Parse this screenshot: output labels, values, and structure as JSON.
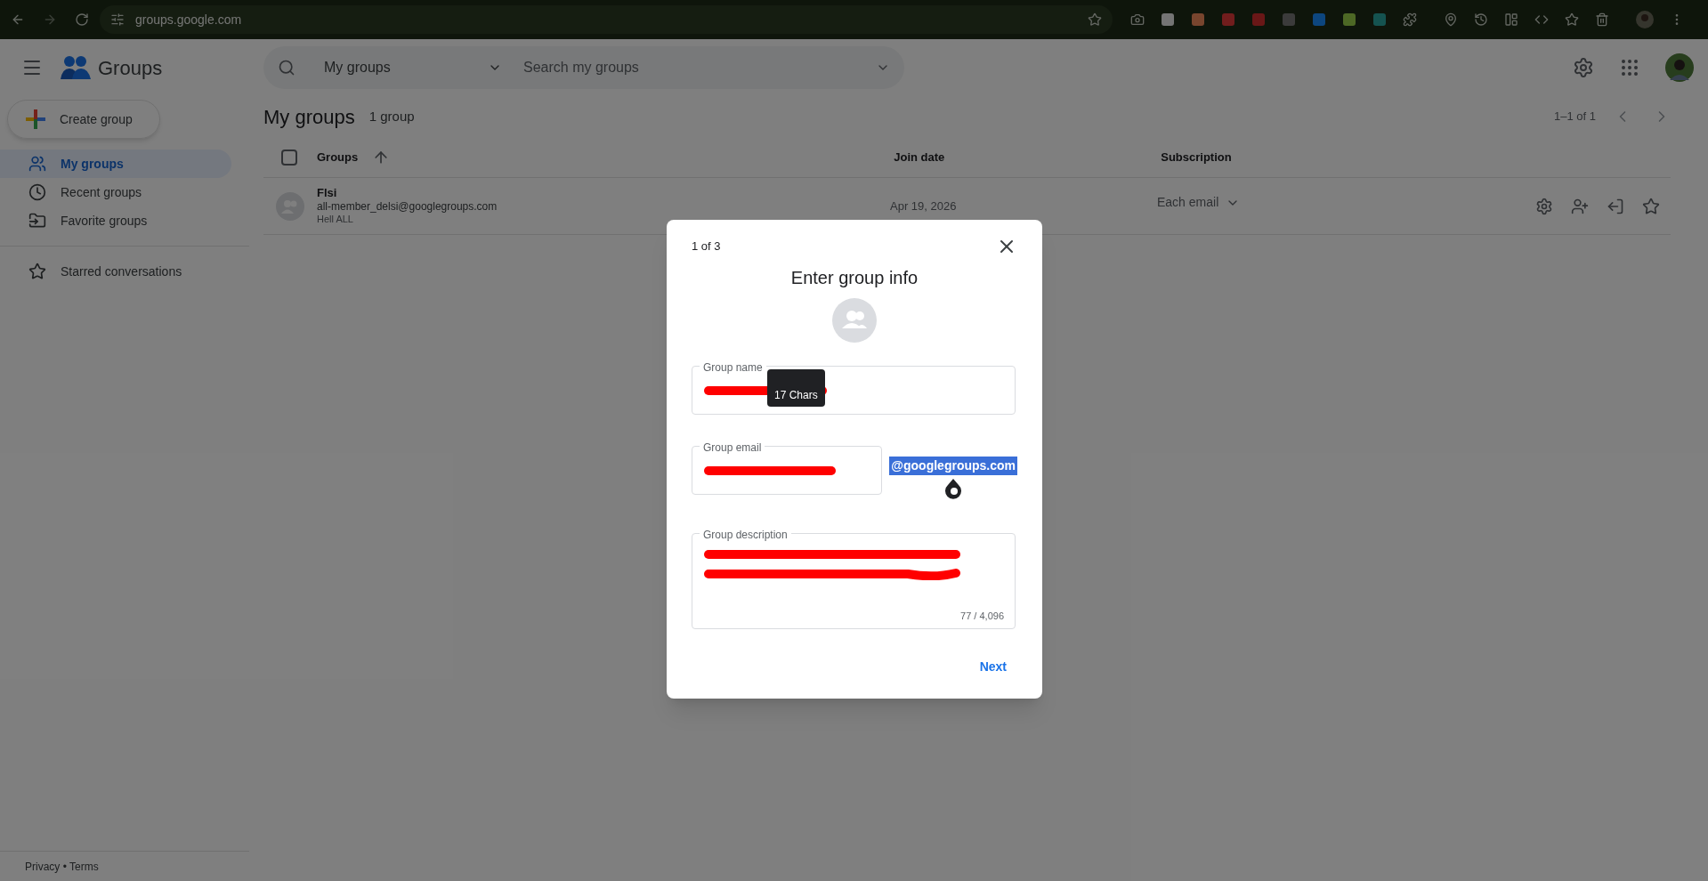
{
  "browser": {
    "url": "groups.google.com"
  },
  "app": {
    "title": "Groups",
    "search": {
      "scope": "My groups",
      "placeholder": "Search my groups"
    }
  },
  "sidebar": {
    "create_button": "Create group",
    "items": [
      {
        "label": "My groups",
        "selected": true,
        "kind": "people"
      },
      {
        "label": "Recent groups",
        "selected": false,
        "kind": "clock"
      },
      {
        "label": "Favorite groups",
        "selected": false,
        "kind": "folder"
      },
      {
        "label": "Starred conversations",
        "selected": false,
        "kind": "star"
      }
    ],
    "footer": "Privacy • Terms"
  },
  "main": {
    "heading": "My groups",
    "count": "1 group",
    "pagination": "1–1 of 1",
    "select_all": {
      "checked": false
    },
    "columns": [
      "Groups",
      "Join date",
      "Subscription"
    ],
    "rows": [
      {
        "name": "Flsi",
        "email": "all-member_delsi@googlegroups.com",
        "description": "Hell ALL",
        "join_date": "Apr 19, 2026",
        "subscription": "Each email"
      }
    ]
  },
  "dialog": {
    "step": "1 of 3",
    "title": "Enter group info",
    "fields": [
      {
        "label": "Group name",
        "kind": "name",
        "redacted": true
      },
      {
        "label": "Group email",
        "kind": "email",
        "redacted": true
      },
      {
        "label": "Group description",
        "kind": "description",
        "redacted": true,
        "counter": "77 / 4,096"
      }
    ],
    "domain": {
      "text": "@googlegroups.com",
      "selected": true
    },
    "tooltip": "17 Chars",
    "next": "Next"
  }
}
